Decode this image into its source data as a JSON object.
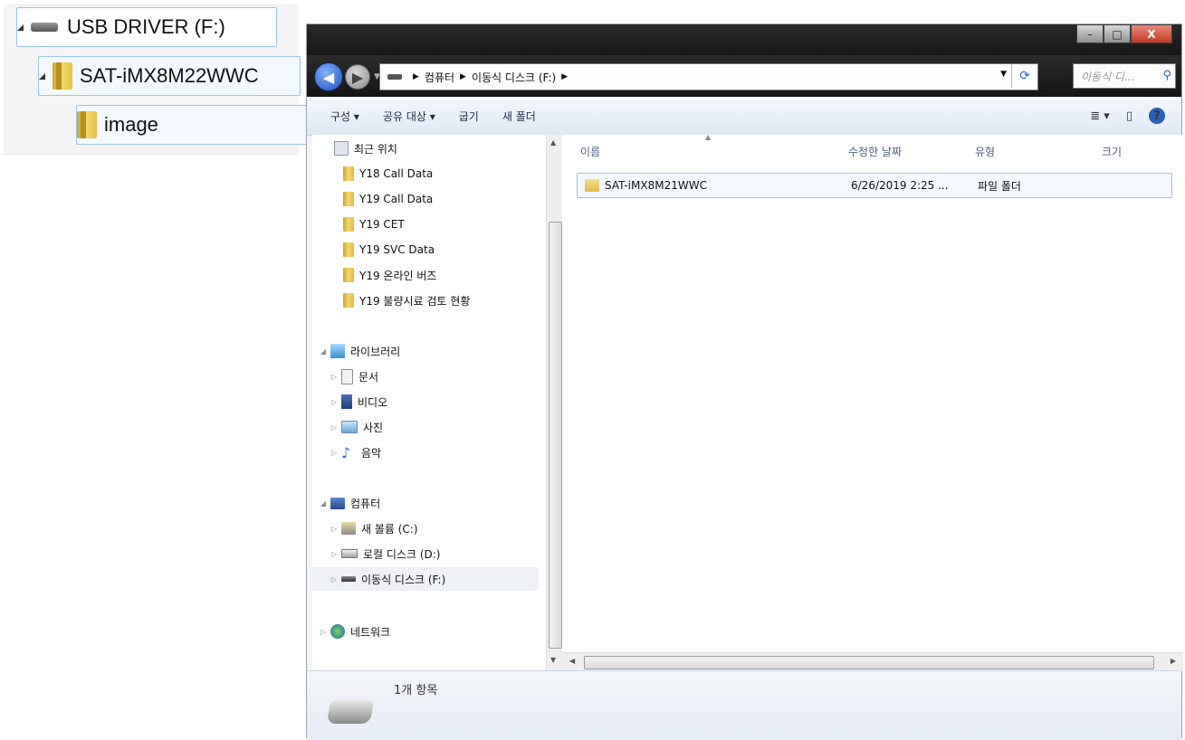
{
  "inset_tree": {
    "drive_label": "USB DRIVER  (F:)",
    "folder_label": "SAT-iMX8M22WWC",
    "subfolder_label": "image"
  },
  "window": {
    "caption": {
      "min": "–",
      "max": "□",
      "close": "X"
    },
    "address": {
      "crumbs": [
        "컴퓨터",
        "이동식 디스크 (F:)"
      ],
      "search_placeholder": "이동식 디..."
    },
    "toolbar": {
      "organize": "구성 ▾",
      "share": "공유 대상 ▾",
      "burn": "굽기",
      "new_folder": "새 폴더",
      "view_icon": "≣ ▾",
      "pane_icon": "▯",
      "help_icon": "?"
    },
    "nav": {
      "recent": "최근 위치",
      "folders": [
        "Y18 Call Data",
        "Y19 Call Data",
        "Y19 CET",
        "Y19 SVC Data",
        "Y19 온라인 버즈",
        "Y19 불량시료 검토 현황"
      ],
      "library": "라이브러리",
      "library_items": [
        "문서",
        "비디오",
        "사진",
        "음악"
      ],
      "computer": "컴퓨터",
      "drives": [
        "새 볼륨 (C:)",
        "로컬 디스크 (D:)",
        "이동식 디스크 (F:)"
      ],
      "network": "네트워크"
    },
    "columns": {
      "name": "이름",
      "modified": "수정한 날짜",
      "type": "유형",
      "size": "크기"
    },
    "files": [
      {
        "name": "SAT-iMX8M21WWC",
        "modified": "6/26/2019 2:25 ...",
        "type": "파일 폴더",
        "size": ""
      }
    ],
    "status": {
      "count": "1개 항목"
    }
  }
}
